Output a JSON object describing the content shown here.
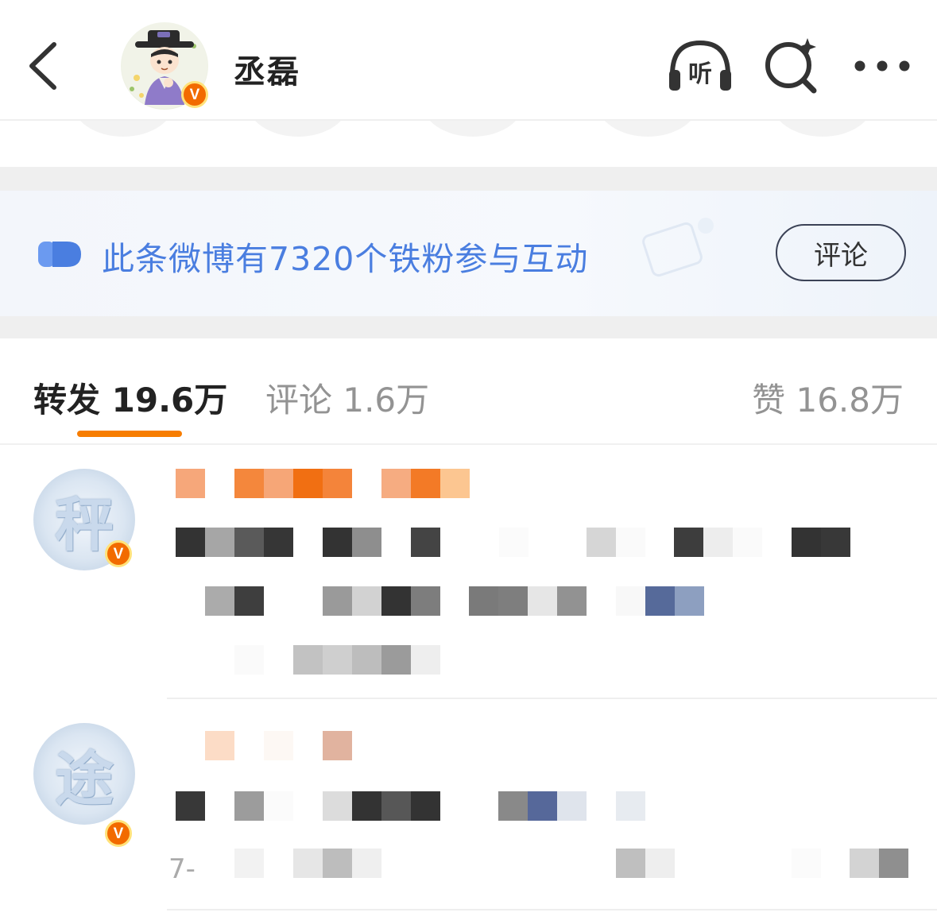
{
  "header": {
    "username": "丞磊",
    "verified_badge": "V",
    "icons": [
      "back-icon",
      "listen-icon",
      "search-icon",
      "more-icon"
    ],
    "listen_label": "听"
  },
  "fan_banner": {
    "text": "此条微博有7320个铁粉参与互动",
    "button_label": "评论",
    "accent_color": "#4a7ee0"
  },
  "tabs": {
    "repost": "转发 19.6万",
    "comment": "评论 1.6万",
    "like": "赞 16.8万",
    "active_color": "#f77d00"
  },
  "feed": {
    "items": [
      {
        "avatar_char": "秤",
        "verified_badge": "V"
      },
      {
        "avatar_char": "途",
        "verified_badge": "V",
        "time_fragment": "7-"
      }
    ]
  }
}
